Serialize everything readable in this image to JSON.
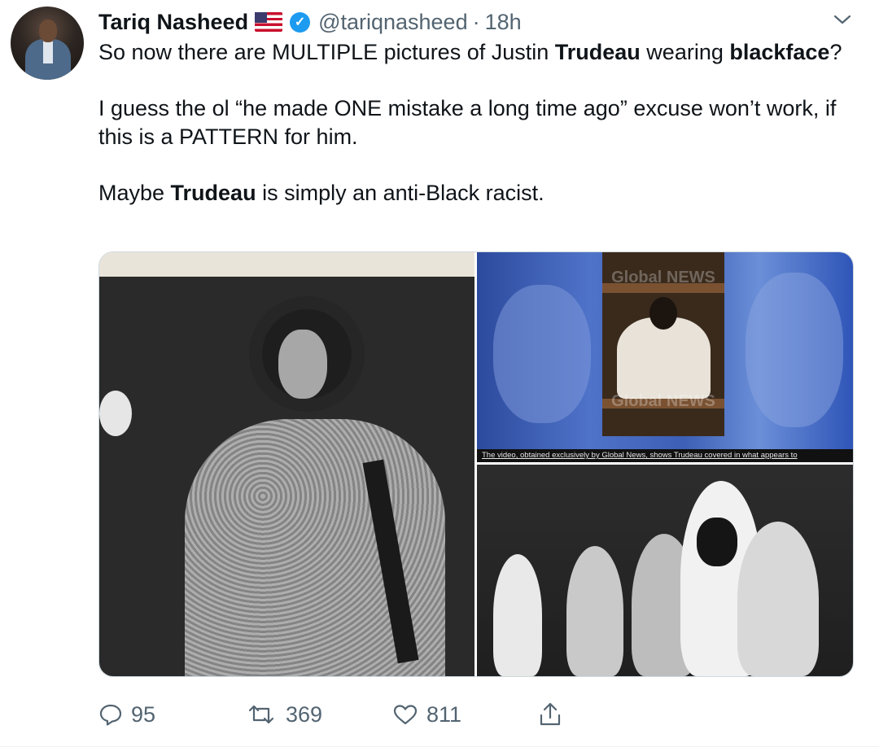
{
  "tweet": {
    "author_name": "Tariq Nasheed",
    "handle": "@tariqnasheed",
    "separator": "·",
    "time": "18h",
    "text": {
      "line1_a": "So now there are MULTIPLE pictures of Justin ",
      "line1_b": "Trudeau",
      "line1_c": " wearing ",
      "line1_d": "blackface",
      "line1_e": "?",
      "para2": "I guess the ol “he made ONE mistake  a long time ago” excuse won’t work, if this is a PATTERN for him.",
      "para3_a": "Maybe ",
      "para3_b": "Trudeau",
      "para3_c": " is simply an anti-Black racist."
    },
    "media": {
      "video_caption": "The video, obtained exclusively by Global News, shows Trudeau covered in what appears to",
      "watermark_top": "Global NEWS",
      "watermark_bottom": "Global NEWS"
    },
    "stats": {
      "replies": "95",
      "retweets": "369",
      "likes": "811"
    }
  },
  "icons": {
    "verified": "verified-badge-icon",
    "flag": "us-flag-icon",
    "more": "chevron-down-icon",
    "reply": "reply-icon",
    "retweet": "retweet-icon",
    "like": "heart-icon",
    "share": "share-icon"
  },
  "colors": {
    "verified_blue": "#1d9bf0",
    "secondary_text": "#536471",
    "primary_text": "#0f1419"
  }
}
